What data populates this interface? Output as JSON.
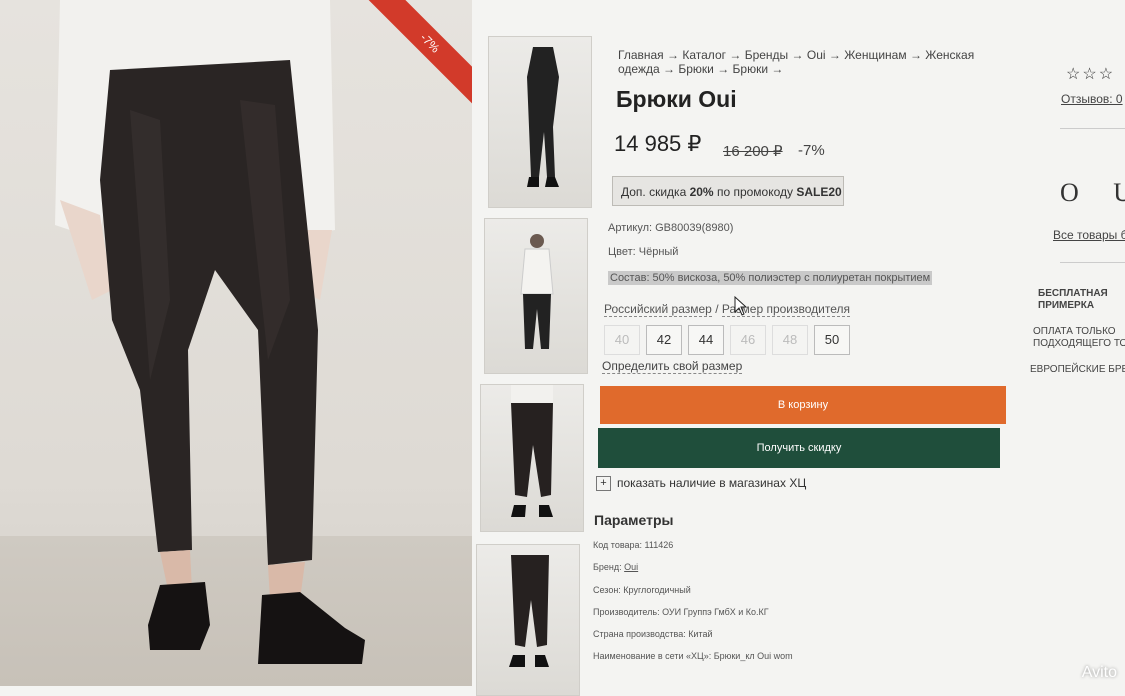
{
  "product": {
    "discount_ribbon": "-7%",
    "breadcrumb": [
      "Главная",
      "Каталог",
      "Бренды",
      "Oui",
      "Женщинам",
      "Женская одежда",
      "Брюки",
      "Брюки"
    ],
    "breadcrumb_sep": "→",
    "title": "Брюки Oui",
    "price": "14 985 ₽",
    "old_price": "16 200 ₽",
    "discount": "-7%",
    "promo": {
      "prefix": "Доп. скидка ",
      "percent": "20%",
      "middle": " по промокоду ",
      "code": "SALE20"
    },
    "article": "Артикул: GB80039(8980)",
    "color": "Цвет: Чёрный",
    "composition": "Состав: 50% вискоза, 50% полиэстер с полиуретан покрытием",
    "size_type_ru": "Российский размер",
    "size_sep": " / ",
    "size_type_maker": "Размер производителя",
    "sizes": [
      {
        "label": "40",
        "available": false
      },
      {
        "label": "42",
        "available": true
      },
      {
        "label": "44",
        "available": true
      },
      {
        "label": "46",
        "available": false
      },
      {
        "label": "48",
        "available": false
      },
      {
        "label": "50",
        "available": true
      }
    ],
    "define_size": "Определить свой размер",
    "add_to_cart": "В корзину",
    "get_discount": "Получить скидку",
    "stock_box": "+",
    "stock_label": "показать наличие в магазинах ХЦ",
    "params_title": "Параметры",
    "params": {
      "code": "Код товара: 111426",
      "brand_label": "Бренд: ",
      "brand_value": "Oui",
      "season": "Сезон: Круглогодичный",
      "maker": "Производитель: ОУИ Группэ ГмбХ и Ко.КГ",
      "country": "Страна производства: Китай",
      "network_name": "Наименование в сети «ХЦ»: Брюки_кл Oui wom"
    }
  },
  "sidebar": {
    "stars": "☆☆☆",
    "reviews": "Отзывов: 0",
    "brand_logo": "O U I",
    "all_goods": "Все товары бренда",
    "features": [
      {
        "line1": "БЕСПЛАТНАЯ",
        "line2": "ПРИМЕРКА"
      },
      {
        "line1": "ОПЛАТА ТОЛЬКО",
        "line2": "ПОДХОДЯЩЕГО ТОВАРА"
      },
      {
        "line1": "ЕВРОПЕЙСКИЕ БРЕНДЫ",
        "line2": ""
      }
    ]
  },
  "watermark": "Avito",
  "colors": {
    "cart_button": "#e06a2c",
    "discount_button": "#1f4e3b",
    "ribbon": "#d23a2a"
  }
}
